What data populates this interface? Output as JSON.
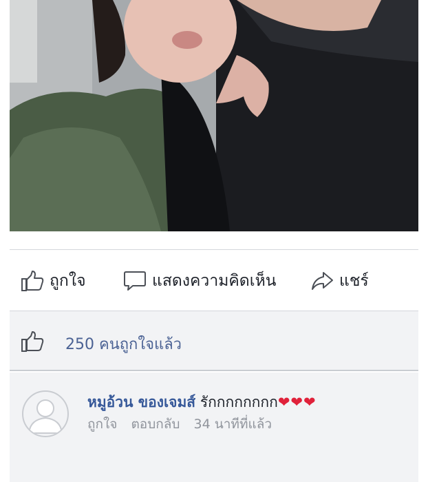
{
  "post": {
    "actions": {
      "like_label": "ถูกใจ",
      "comment_label": "แสดงความคิดเห็น",
      "share_label": "แชร์"
    },
    "likes": {
      "summary": "250 คนถูกใจแล้ว"
    },
    "comment": {
      "author": "หมูอ้วน ของเจมส์",
      "text": "รักกกกกกกก",
      "hearts": "❤❤❤",
      "like_label": "ถูกใจ",
      "reply_label": "ตอบกลับ",
      "timestamp": "34 นาทีที่แล้ว"
    }
  }
}
